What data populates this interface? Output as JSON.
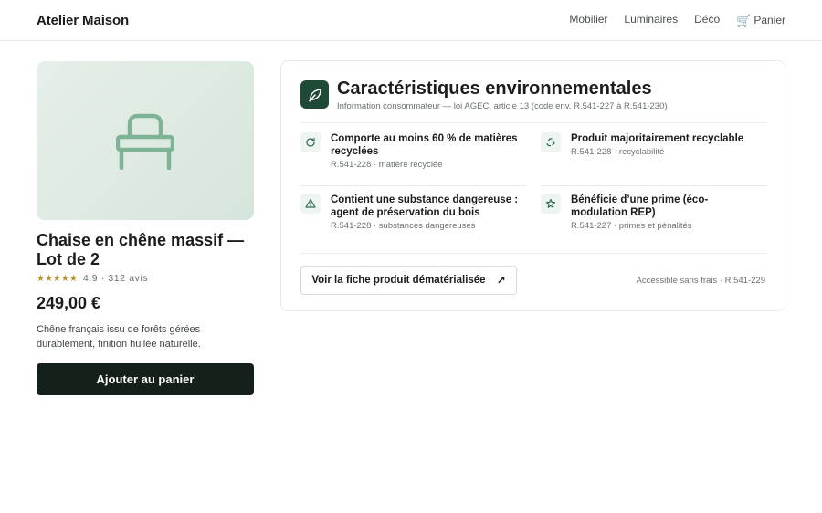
{
  "header": {
    "brand": "Atelier Maison",
    "nav": [
      "Mobilier",
      "Luminaires",
      "Déco"
    ],
    "cart_label": "Panier",
    "cart_icon": "cart-icon"
  },
  "product": {
    "image_icon": "chair-icon",
    "title": "Chaise en chêne massif — Lot de 2",
    "stars": "★★★★★",
    "rating": "4,9 · 312 avis",
    "price": "249,00 €",
    "description": "Chêne français issu de forêts gérées durablement, finition huilée naturelle.",
    "add_to_cart": "Ajouter au panier"
  },
  "environment": {
    "badge_icon": "leaf-icon",
    "title": "Caractéristiques environnementales",
    "subtitle": "Information consommateur — loi AGEC, article 13 (code env. R.541-227 à R.541-230)",
    "items": [
      {
        "icon": "refresh-icon",
        "title": "Comporte au moins 60 % de matières recyclées",
        "ref": "R.541-228 · matière recyclée"
      },
      {
        "icon": "recycle-icon",
        "title": "Produit majoritairement recyclable",
        "ref": "R.541-228 · recyclabilité"
      },
      {
        "icon": "warning-icon",
        "title": "Contient une substance dangereuse : agent de préservation du bois",
        "ref": "R.541-228 · substances dangereuses"
      },
      {
        "icon": "star-icon",
        "title": "Bénéficie d’une prime (éco-modulation REP)",
        "ref": "R.541-227 · primes et pénalités"
      }
    ],
    "sheet_button": "Voir la fiche produit dématérialisée",
    "sheet_arrow": "↗",
    "access_note": "Accessible sans frais · R.541-229"
  },
  "colors": {
    "accent": "#1f4a37",
    "icon_green": "#7fb395",
    "button_dark": "#16201b",
    "stars": "#b8902b"
  }
}
